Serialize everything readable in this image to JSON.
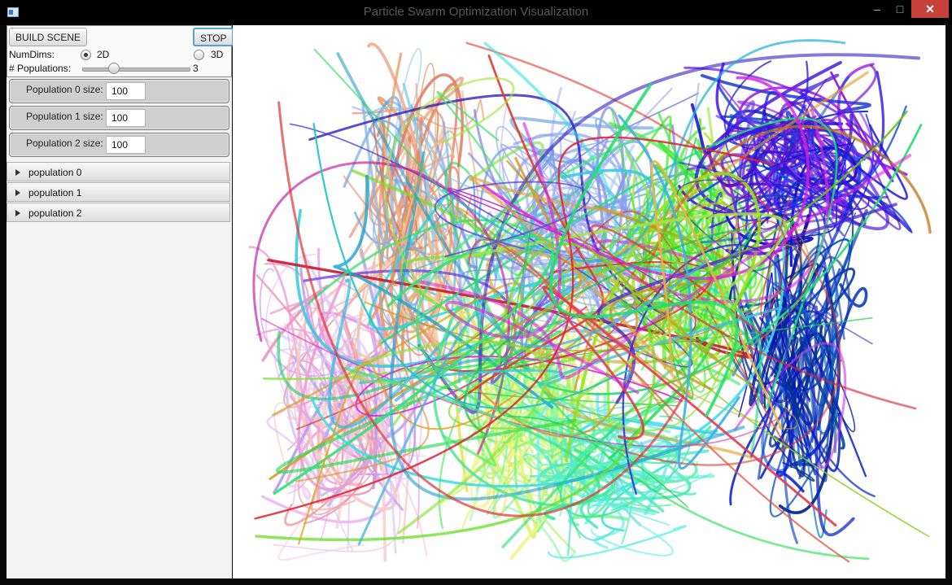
{
  "window": {
    "title": "Particle Swarm Optimization Visualization",
    "minimize_glyph": "–",
    "maximize_glyph": "□",
    "close_glyph": "✕"
  },
  "controls": {
    "build_label": "BUILD SCENE",
    "stop_label": "STOP",
    "numdims_label": "NumDims:",
    "option_2d": "2D",
    "option_3d": "3D",
    "selected_dims": "2D",
    "populations_label": "# Populations:",
    "populations_value": "3",
    "populations_slider_fraction": 0.2
  },
  "population_sizes": [
    {
      "label": "Population 0 size:",
      "value": "100"
    },
    {
      "label": "Population 1 size:",
      "value": "100"
    },
    {
      "label": "Population 2 size:",
      "value": "100"
    }
  ],
  "population_panes": [
    {
      "label": "population 0",
      "expanded": false
    },
    {
      "label": "population 1",
      "expanded": false
    },
    {
      "label": "population 2",
      "expanded": false
    }
  ],
  "colors": {
    "titlebar": "#000000",
    "close_button": "#c7413b",
    "focus_ring": "#4da3db",
    "canvas_bg": "#ffffff"
  }
}
